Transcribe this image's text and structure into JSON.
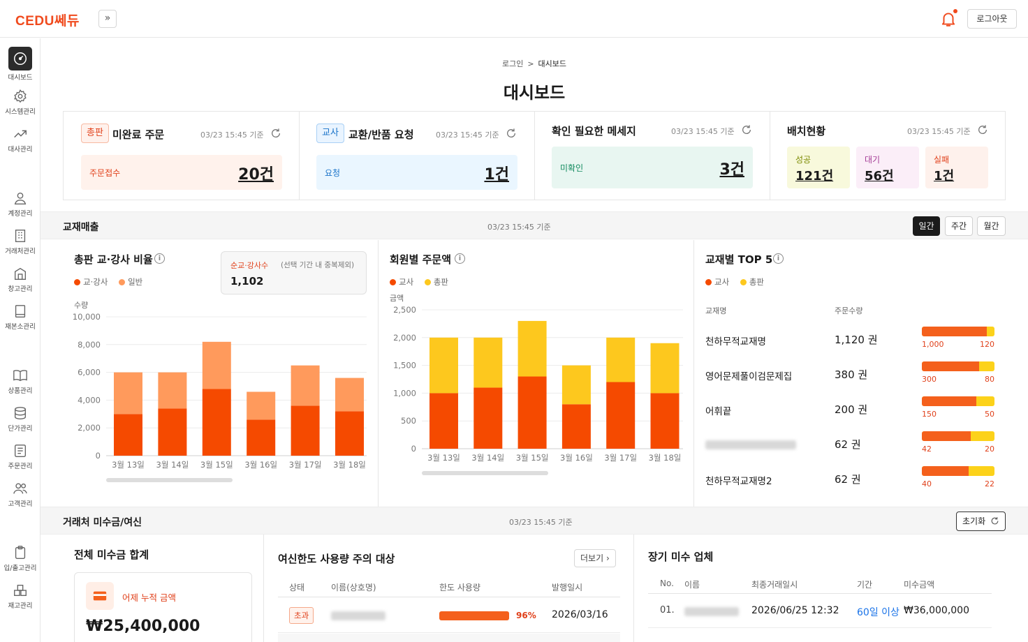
{
  "app": {
    "logo": "CEDU쎄듀",
    "logout": "로그아웃",
    "expand": "»"
  },
  "sidebar": [
    {
      "label": "대시보드",
      "icon": "dashboard-icon",
      "active": true
    },
    {
      "label": "시스템관리",
      "icon": "gear-icon"
    },
    {
      "label": "대사관리",
      "icon": "trend-icon"
    },
    {
      "label": "계정관리",
      "icon": "user-icon"
    },
    {
      "label": "거래처관리",
      "icon": "building-icon"
    },
    {
      "label": "창고관리",
      "icon": "warehouse-icon"
    },
    {
      "label": "재본소관리",
      "icon": "book-box-icon"
    },
    {
      "label": "상품관리",
      "icon": "book-open-icon"
    },
    {
      "label": "단가관리",
      "icon": "coins-icon"
    },
    {
      "label": "주문관리",
      "icon": "list-icon"
    },
    {
      "label": "고객관리",
      "icon": "people-icon"
    },
    {
      "label": "입/출고관리",
      "icon": "clipboard-icon"
    },
    {
      "label": "재고관리",
      "icon": "boxes-icon"
    }
  ],
  "breadcrumb": {
    "home": "로그인",
    "sep": ">",
    "current": "대시보드"
  },
  "page_title": "대시보드",
  "cards": {
    "c1": {
      "badge": "총판",
      "title": "미완료 주문",
      "time": "03/23 15:45 기준",
      "label": "주문접수",
      "value": "20건"
    },
    "c2": {
      "badge": "교사",
      "title": "교환/반품 요청",
      "time": "03/23 15:45 기준",
      "label": "요청",
      "value": "1건"
    },
    "c3": {
      "title": "확인 필요한 메세지",
      "time": "03/23 15:45 기준",
      "label": "미확인",
      "value": "3건"
    },
    "c4": {
      "title": "배치현황",
      "time": "03/23 15:45 기준",
      "success_label": "성공",
      "success_value": "121건",
      "wait_label": "대기",
      "wait_value": "56건",
      "fail_label": "실패",
      "fail_value": "1건"
    }
  },
  "sales": {
    "title": "교재매출",
    "time": "03/23 15:45 기준",
    "periods": [
      "일간",
      "주간",
      "월간"
    ],
    "ratio": {
      "title": "총판 교·강사 비율",
      "legend": [
        "교·강사",
        "일반"
      ],
      "summary_label": "순교·강사수",
      "summary_note": "(선택 기간 내 중복제외)",
      "summary_value": "1,102",
      "ylabel": "수량"
    },
    "member": {
      "title": "회원별 주문액",
      "legend": [
        "교사",
        "총판"
      ],
      "ylabel": "금액"
    },
    "top5": {
      "title": "교재별 TOP 5",
      "legend": [
        "교사",
        "총판"
      ],
      "col_name": "교재명",
      "col_qty": "주문수량",
      "rows": [
        {
          "name": "천하무적교재명",
          "qty": "1,120 권",
          "teacher": 1000,
          "teacher_label": "1,000",
          "dist": 120,
          "dist_label": "120",
          "blur": false
        },
        {
          "name": "영어문제풀이검문제집",
          "qty": "380 권",
          "teacher": 300,
          "teacher_label": "300",
          "dist": 80,
          "dist_label": "80",
          "blur": false
        },
        {
          "name": "어휘끝",
          "qty": "200 권",
          "teacher": 150,
          "teacher_label": "150",
          "dist": 50,
          "dist_label": "50",
          "blur": false
        },
        {
          "name": "",
          "qty": "62 권",
          "teacher": 42,
          "teacher_label": "42",
          "dist": 20,
          "dist_label": "20",
          "blur": true
        },
        {
          "name": "천하무적교재명2",
          "qty": "62 권",
          "teacher": 40,
          "teacher_label": "40",
          "dist": 22,
          "dist_label": "22",
          "blur": false
        }
      ]
    }
  },
  "chart_data": [
    {
      "type": "bar",
      "title": "총판 교·강사 비율",
      "ylabel": "수량",
      "categories": [
        "3월 13일",
        "3월 14일",
        "3월 15일",
        "3월 16일",
        "3월 17일",
        "3월 18일"
      ],
      "series": [
        {
          "name": "교·강사",
          "values": [
            3000,
            3400,
            4800,
            2600,
            3600,
            3200
          ],
          "color": "#f54a00"
        },
        {
          "name": "일반",
          "values": [
            3000,
            2600,
            3400,
            2000,
            2900,
            2400
          ],
          "color": "#ff9a5c"
        }
      ],
      "ylim": [
        0,
        10000
      ],
      "yticks": [
        "10,000",
        "8,000",
        "6,000",
        "4,000",
        "2,000",
        "0"
      ],
      "stacked": true
    },
    {
      "type": "bar",
      "title": "회원별 주문액",
      "ylabel": "금액",
      "categories": [
        "3월 13일",
        "3월 14일",
        "3월 15일",
        "3월 16일",
        "3월 17일",
        "3월 18일"
      ],
      "series": [
        {
          "name": "교사",
          "values": [
            1000,
            1100,
            1300,
            800,
            1200,
            1000
          ],
          "color": "#f54a00"
        },
        {
          "name": "총판",
          "values": [
            1000,
            900,
            1000,
            700,
            800,
            900
          ],
          "color": "#fdc81e"
        }
      ],
      "ylim": [
        0,
        2500
      ],
      "yticks": [
        "2,500",
        "2,000",
        "1,500",
        "1,000",
        "500",
        "0"
      ],
      "stacked": true
    }
  ],
  "receivables": {
    "title": "거래처 미수금/여신",
    "time": "03/23 15:45 기준",
    "reset": "초기화",
    "total": {
      "title": "전체 미수금 합계",
      "label": "어제 누적 금액",
      "value": "₩25,400,000"
    },
    "credit": {
      "title": "여신한도 사용량 주의 대상",
      "more": "더보기",
      "cols": [
        "상태",
        "이름(상호명)",
        "한도 사용량",
        "발행일시"
      ],
      "rows": [
        {
          "status": "초과",
          "name": "",
          "usage": 96,
          "usage_label": "96%",
          "date": "2026/03/16"
        }
      ]
    },
    "overdue": {
      "title": "장기 미수 업체",
      "cols": [
        "No.",
        "이름",
        "최종거래일시",
        "기간",
        "미수금액"
      ],
      "rows": [
        {
          "no": "01.",
          "name": "",
          "date": "2026/06/25 12:32",
          "period": "60일 이상",
          "amount": "₩36,000,000"
        }
      ]
    }
  },
  "colors": {
    "accent": "#f04a1d",
    "teacher": "#f54a00",
    "general": "#ff9a5c",
    "dist": "#fdc81e"
  }
}
